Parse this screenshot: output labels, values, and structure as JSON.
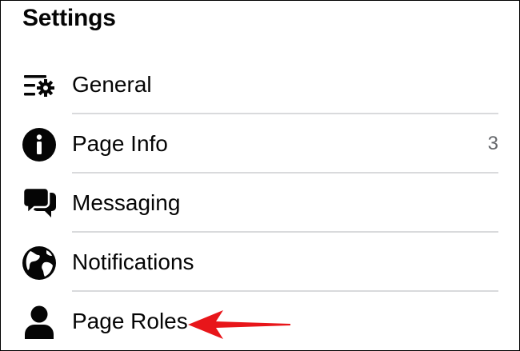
{
  "header": {
    "title": "Settings"
  },
  "menu": {
    "items": [
      {
        "label": "General",
        "icon": "general-settings-icon",
        "count": ""
      },
      {
        "label": "Page Info",
        "icon": "info-icon",
        "count": "3"
      },
      {
        "label": "Messaging",
        "icon": "messaging-icon",
        "count": ""
      },
      {
        "label": "Notifications",
        "icon": "globe-icon",
        "count": ""
      },
      {
        "label": "Page Roles",
        "icon": "person-icon",
        "count": ""
      }
    ]
  },
  "annotation": {
    "arrow_color": "#e8161a",
    "arrow_icon": "red-arrow-pointing-left"
  },
  "colors": {
    "text": "#050505",
    "secondary_text": "#65676b",
    "divider": "#d9dadc"
  }
}
